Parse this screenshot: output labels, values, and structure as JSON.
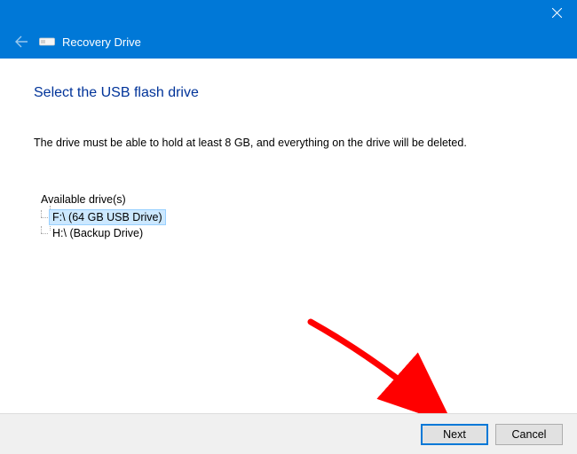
{
  "titlebar": {
    "close_icon": "close"
  },
  "header": {
    "back_icon": "back-arrow",
    "drive_icon": "drive",
    "title": "Recovery Drive"
  },
  "main": {
    "page_title": "Select the USB flash drive",
    "instruction": "The drive must be able to hold at least 8 GB, and everything on the drive will be deleted.",
    "drives_label": "Available drive(s)",
    "drives": [
      {
        "label": "F:\\ (64 GB USB Drive)",
        "selected": true
      },
      {
        "label": "H:\\ (Backup Drive)",
        "selected": false
      }
    ]
  },
  "footer": {
    "next_label": "Next",
    "cancel_label": "Cancel"
  }
}
